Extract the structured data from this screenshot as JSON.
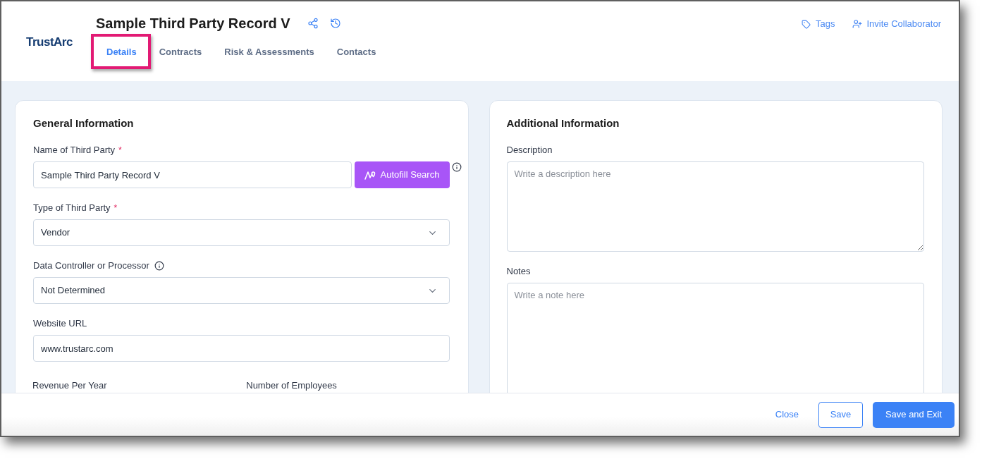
{
  "header": {
    "logo": "TrustArc",
    "title": "Sample Third Party Record V",
    "tabs": [
      {
        "label": "Details",
        "selected": true,
        "highlighted": true
      },
      {
        "label": "Contracts",
        "selected": false,
        "highlighted": false
      },
      {
        "label": "Risk & Assessments",
        "selected": false,
        "highlighted": false
      },
      {
        "label": "Contacts",
        "selected": false,
        "highlighted": false
      }
    ],
    "actions": [
      {
        "kind": "tags",
        "label": "Tags"
      },
      {
        "kind": "invite",
        "label": "Invite Collaborator"
      }
    ]
  },
  "general_information": {
    "title": "General Information",
    "fields": [
      {
        "kind": "text",
        "label": "Name of Third Party",
        "required_mark": "*",
        "value": "Sample Third Party Record V",
        "button": "Autofill Search",
        "info": true
      },
      {
        "kind": "select",
        "label": "Type of Third Party",
        "required_mark": "*",
        "value": "Vendor"
      },
      {
        "kind": "select",
        "label": "Data Controller or Processor",
        "info": true,
        "value": "Not Determined"
      },
      {
        "kind": "text",
        "label": "Website URL",
        "value": "www.trustarc.com"
      },
      {
        "kind": "pair",
        "labels": [
          "Revenue Per Year",
          "Number of Employees"
        ]
      }
    ]
  },
  "additional_information": {
    "title": "Additional Information",
    "fields": [
      {
        "label": "Description",
        "placeholder": "Write a description here"
      },
      {
        "label": "Notes",
        "placeholder": "Write a note here"
      }
    ]
  },
  "footer": {
    "buttons": [
      {
        "kind": "link",
        "label": "Close"
      },
      {
        "kind": "outline",
        "label": "Save"
      },
      {
        "kind": "primary",
        "label": "Save and Exit"
      }
    ]
  }
}
